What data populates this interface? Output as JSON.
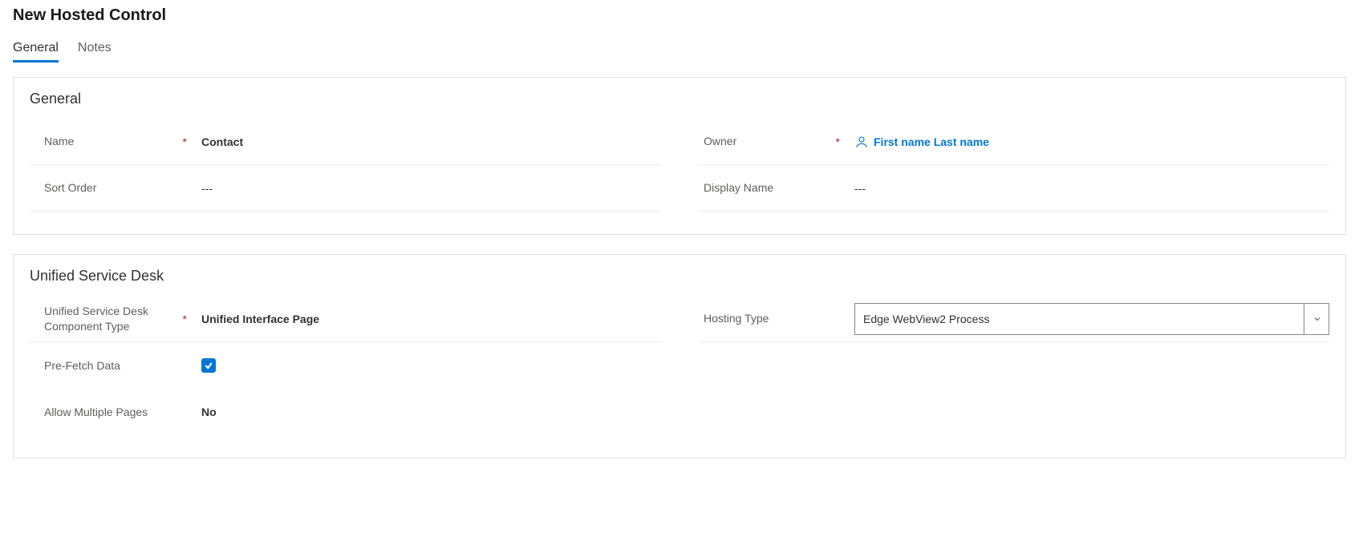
{
  "page_title": "New Hosted Control",
  "tabs": {
    "general": "General",
    "notes": "Notes"
  },
  "general_section": {
    "title": "General",
    "fields": {
      "name_label": "Name",
      "name_value": "Contact",
      "sort_order_label": "Sort Order",
      "sort_order_value": "---",
      "owner_label": "Owner",
      "owner_value": "First name Last name",
      "display_name_label": "Display Name",
      "display_name_value": "---"
    }
  },
  "usd_section": {
    "title": "Unified Service Desk",
    "fields": {
      "component_type_label": "Unified Service Desk Component Type",
      "component_type_value": "Unified Interface Page",
      "prefetch_label": "Pre-Fetch Data",
      "prefetch_checked": true,
      "allow_multiple_label": "Allow Multiple Pages",
      "allow_multiple_value": "No",
      "hosting_type_label": "Hosting Type",
      "hosting_type_value": "Edge WebView2 Process"
    }
  },
  "required_marker": "*"
}
